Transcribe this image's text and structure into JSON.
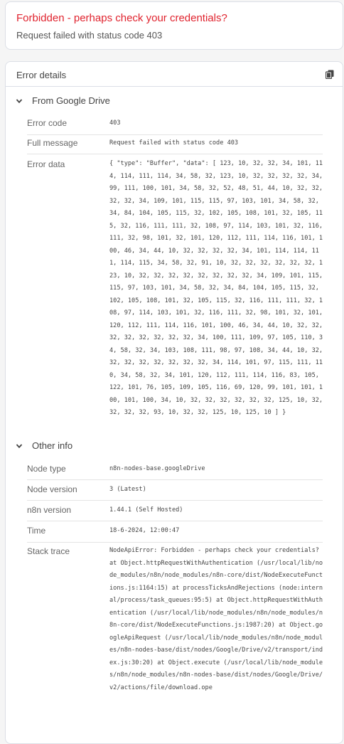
{
  "error": {
    "title": "Forbidden - perhaps check your credentials?",
    "subtitle": "Request failed with status code 403"
  },
  "details": {
    "title": "Error details",
    "copy_icon": "copy-icon",
    "sections": [
      {
        "label": "From Google Drive",
        "rows": [
          {
            "key": "Error code",
            "value": "403"
          },
          {
            "key": "Full message",
            "value": "Request failed with status code 403"
          },
          {
            "key": "Error data",
            "value": "{ \"type\": \"Buffer\", \"data\": [ 123, 10, 32, 32, 34, 101, 114, 114, 111, 114, 34, 58, 32, 123, 10, 32, 32, 32, 32, 34, 99, 111, 100, 101, 34, 58, 32, 52, 48, 51, 44, 10, 32, 32, 32, 32, 34, 109, 101, 115, 115, 97, 103, 101, 34, 58, 32, 34, 84, 104, 105, 115, 32, 102, 105, 108, 101, 32, 105, 115, 32, 116, 111, 111, 32, 108, 97, 114, 103, 101, 32, 116, 111, 32, 98, 101, 32, 101, 120, 112, 111, 114, 116, 101, 100, 46, 34, 44, 10, 32, 32, 32, 32, 34, 101, 114, 114, 111, 114, 115, 34, 58, 32, 91, 10, 32, 32, 32, 32, 32, 32, 123, 10, 32, 32, 32, 32, 32, 32, 32, 32, 34, 109, 101, 115, 115, 97, 103, 101, 34, 58, 32, 34, 84, 104, 105, 115, 32, 102, 105, 108, 101, 32, 105, 115, 32, 116, 111, 111, 32, 108, 97, 114, 103, 101, 32, 116, 111, 32, 98, 101, 32, 101, 120, 112, 111, 114, 116, 101, 100, 46, 34, 44, 10, 32, 32, 32, 32, 32, 32, 32, 32, 34, 100, 111, 109, 97, 105, 110, 34, 58, 32, 34, 103, 108, 111, 98, 97, 108, 34, 44, 10, 32, 32, 32, 32, 32, 32, 32, 32, 34, 114, 101, 97, 115, 111, 110, 34, 58, 32, 34, 101, 120, 112, 111, 114, 116, 83, 105, 122, 101, 76, 105, 109, 105, 116, 69, 120, 99, 101, 101, 100, 101, 100, 34, 10, 32, 32, 32, 32, 32, 32, 125, 10, 32, 32, 32, 32, 93, 10, 32, 32, 125, 10, 125, 10 ] }"
          }
        ]
      },
      {
        "label": "Other info",
        "rows": [
          {
            "key": "Node type",
            "value": "n8n-nodes-base.googleDrive"
          },
          {
            "key": "Node version",
            "value": "3 (Latest)"
          },
          {
            "key": "n8n version",
            "value": "1.44.1 (Self Hosted)"
          },
          {
            "key": "Time",
            "value": "18-6-2024, 12:00:47"
          },
          {
            "key": "Stack trace",
            "value": "NodeApiError: Forbidden - perhaps check your credentials? at Object.httpRequestWithAuthentication (/usr/local/lib/node_modules/n8n/node_modules/n8n-core/dist/NodeExecuteFunctions.js:1164:15) at processTicksAndRejections (node:internal/process/task_queues:95:5) at Object.httpRequestWithAuthentication (/usr/local/lib/node_modules/n8n/node_modules/n8n-core/dist/NodeExecuteFunctions.js:1987:20) at Object.googleApiRequest (/usr/local/lib/node_modules/n8n/node_modules/n8n-nodes-base/dist/nodes/Google/Drive/v2/transport/index.js:30:20) at Object.execute (/usr/local/lib/node_modules/n8n/node_modules/n8n-nodes-base/dist/nodes/Google/Drive/v2/actions/file/download.ope"
          }
        ]
      }
    ]
  },
  "colors": {
    "error_red": "#e0232e",
    "panel_border": "#dcdfe6",
    "row_divider": "#e4e4e4"
  }
}
